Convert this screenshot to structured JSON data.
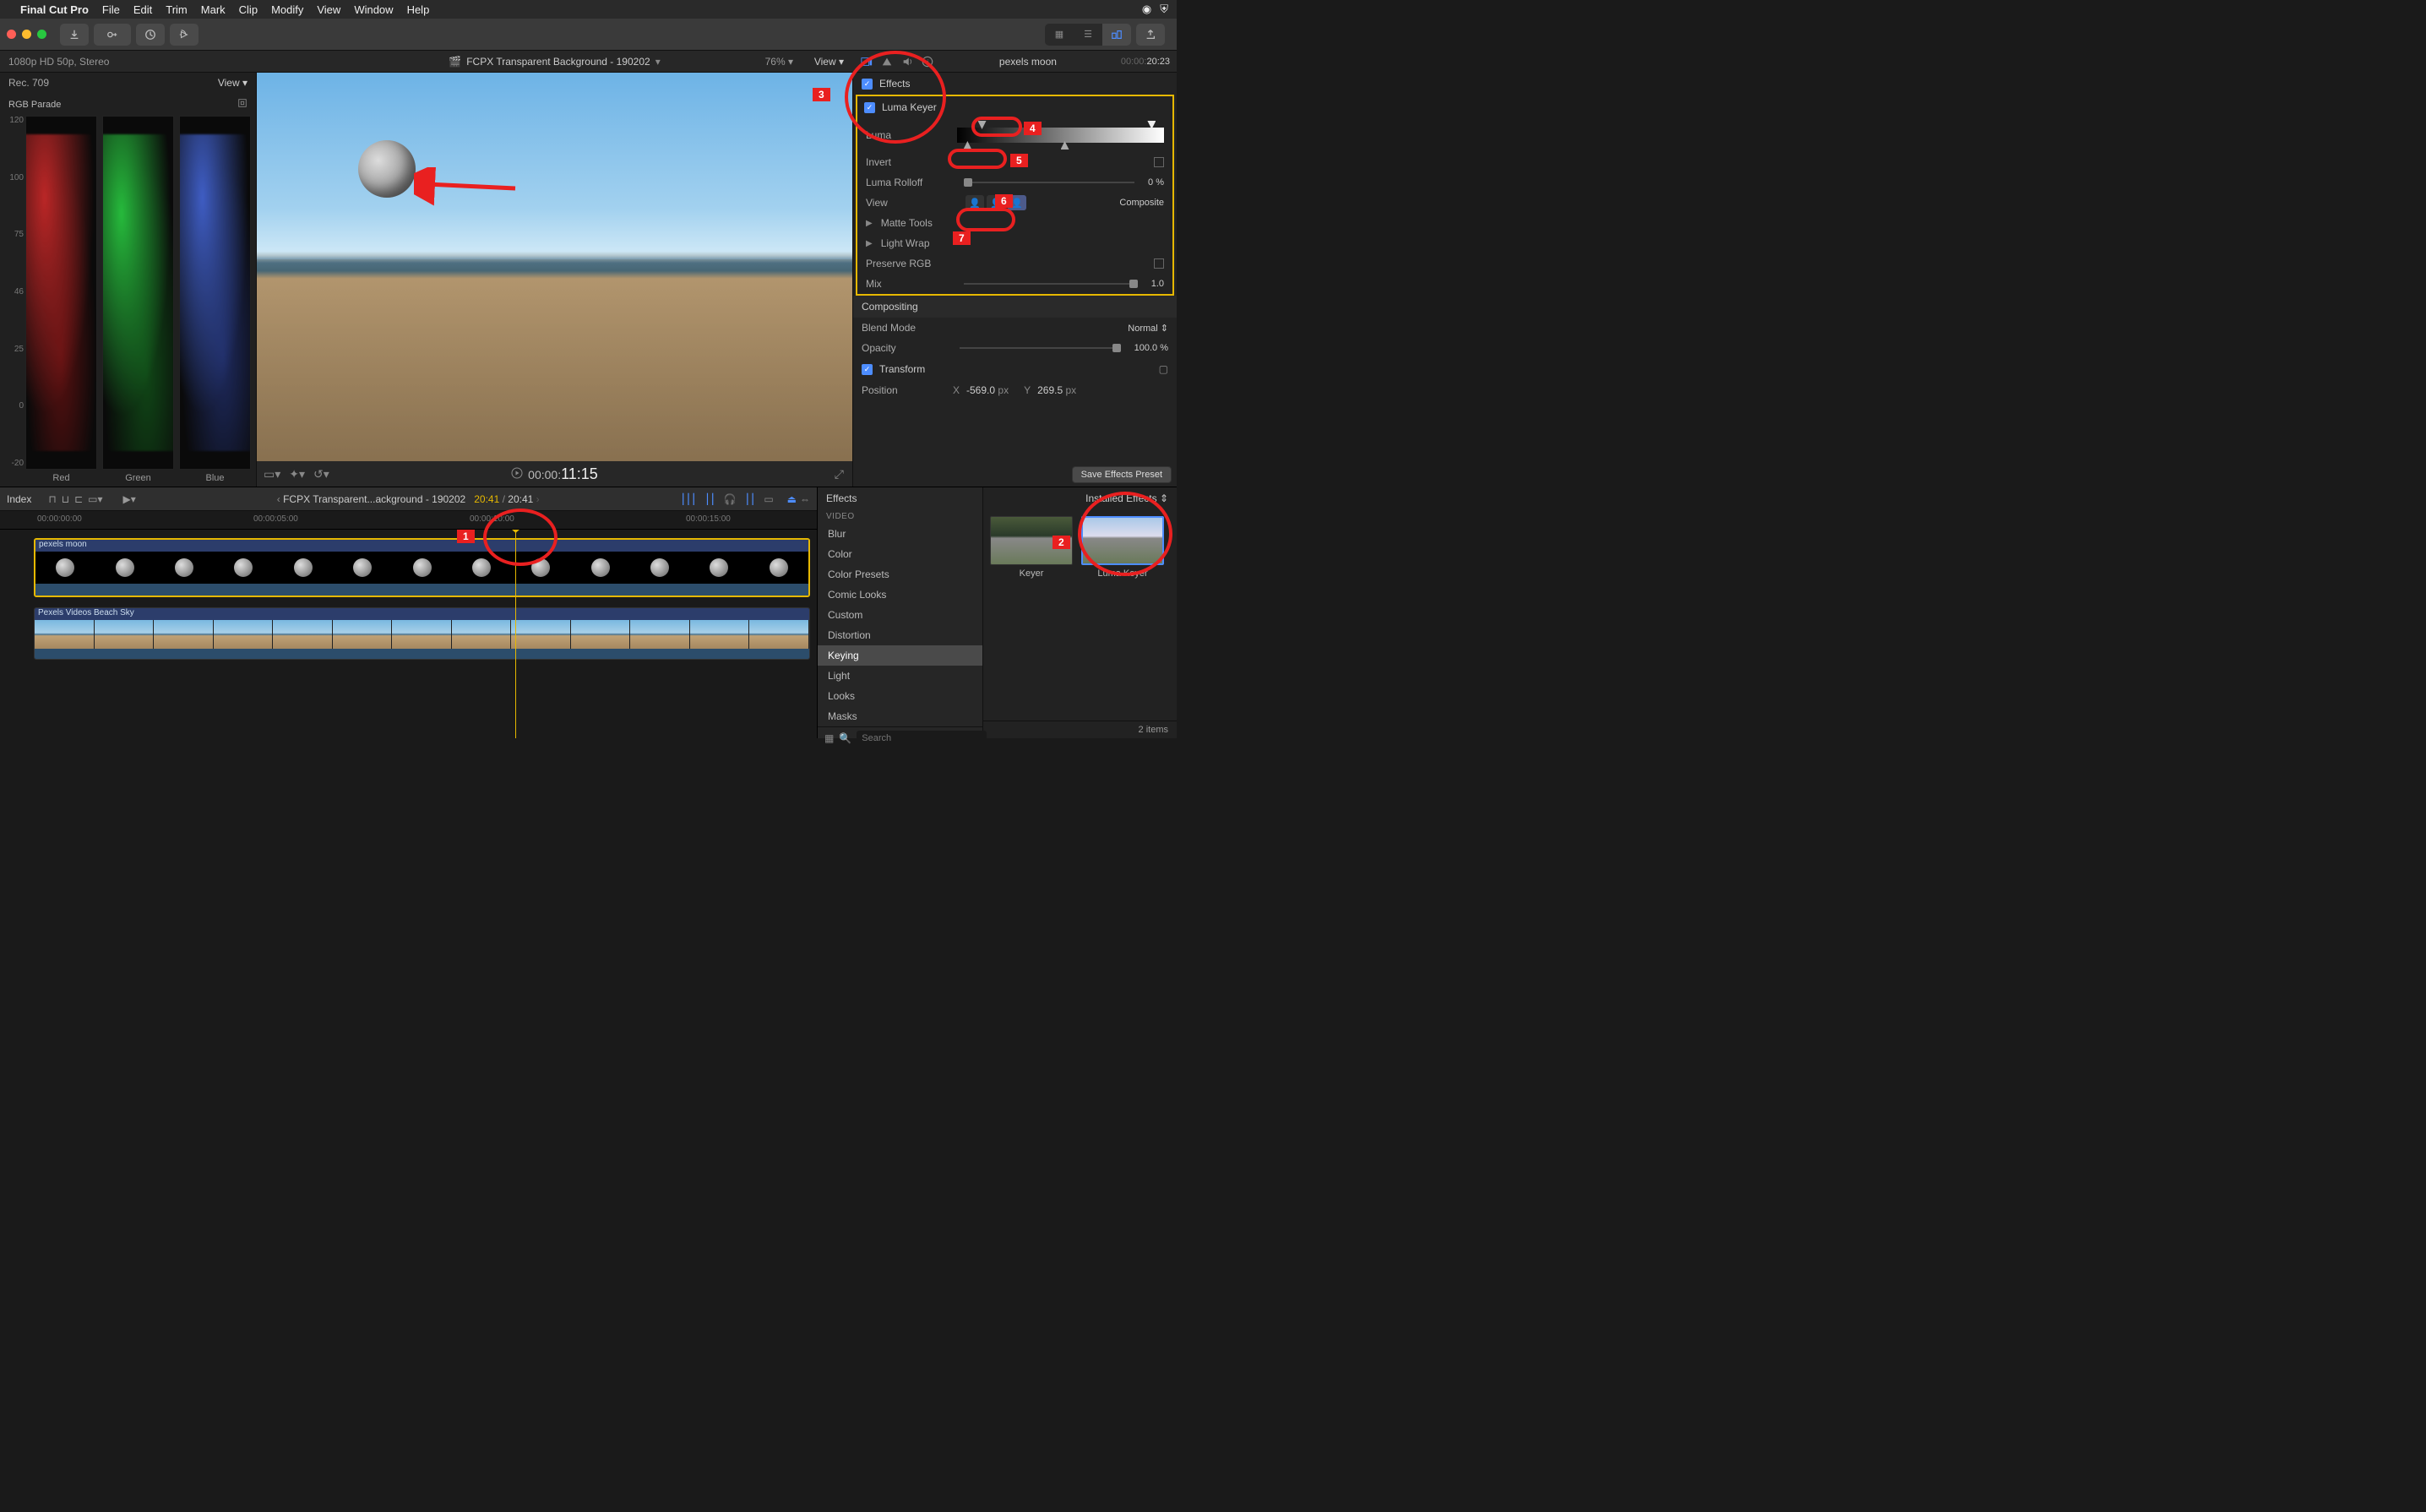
{
  "menubar": {
    "app": "Final Cut Pro",
    "items": [
      "File",
      "Edit",
      "Trim",
      "Mark",
      "Clip",
      "Modify",
      "View",
      "Window",
      "Help"
    ]
  },
  "subheader": {
    "format": "1080p HD 50p, Stereo",
    "project_title": "FCPX Transparent Background - 190202",
    "zoom": "76%",
    "view_label": "View"
  },
  "scopes": {
    "title": "Rec. 709",
    "view_label": "View",
    "mode": "RGB Parade",
    "y_ticks": [
      "120",
      "100",
      "75",
      "46",
      "25",
      "0",
      "-20"
    ],
    "channels": [
      "Red",
      "Green",
      "Blue"
    ]
  },
  "viewer": {
    "timecode_prefix": "00:00:",
    "timecode_frames": "11:15"
  },
  "inspector": {
    "clip_name": "pexels moon",
    "tc_prefix": "00:00:",
    "duration": "20:23",
    "effects_header": "Effects",
    "luma_keyer": "Luma Keyer",
    "rows": {
      "luma": "Luma",
      "invert": "Invert",
      "luma_rolloff": "Luma Rolloff",
      "luma_rolloff_val": "0 %",
      "view": "View",
      "view_val": "Composite",
      "matte_tools": "Matte Tools",
      "light_wrap": "Light Wrap",
      "preserve_rgb": "Preserve RGB",
      "mix": "Mix",
      "mix_val": "1.0"
    },
    "compositing": "Compositing",
    "blend_mode": "Blend Mode",
    "blend_mode_val": "Normal",
    "opacity": "Opacity",
    "opacity_val": "100.0 %",
    "transform": "Transform",
    "position": "Position",
    "pos_x_label": "X",
    "pos_x": "-569.0",
    "pos_x_unit": "px",
    "pos_y_label": "Y",
    "pos_y": "269.5",
    "pos_y_unit": "px",
    "save_preset": "Save Effects Preset"
  },
  "timeline": {
    "index_label": "Index",
    "breadcrumb": "FCPX Transparent...ackground - 190202",
    "current_tc": "20:41",
    "total_tc": "20:41",
    "ruler_ticks": [
      {
        "pos": 44,
        "label": "00:00:00:00"
      },
      {
        "pos": 300,
        "label": "00:00:05:00"
      },
      {
        "pos": 556,
        "label": "00:00:10:00"
      },
      {
        "pos": 812,
        "label": "00:00:15:00"
      }
    ],
    "clips": {
      "moon": "pexels moon",
      "beach": "Pexels Videos Beach Sky"
    }
  },
  "effects_browser": {
    "title": "Effects",
    "installed_label": "Installed Effects",
    "video_group": "VIDEO",
    "categories": [
      "Blur",
      "Color",
      "Color Presets",
      "Comic Looks",
      "Custom",
      "Distortion",
      "Keying",
      "Light",
      "Looks",
      "Masks"
    ],
    "selected_category": "Keying",
    "items": [
      {
        "label": "Keyer"
      },
      {
        "label": "Luma Keyer"
      }
    ],
    "search_placeholder": "Search",
    "item_count": "2 items"
  },
  "annotations": {
    "n1": "1",
    "n2": "2",
    "n3": "3",
    "n4": "4",
    "n5": "5",
    "n6": "6",
    "n7": "7"
  }
}
